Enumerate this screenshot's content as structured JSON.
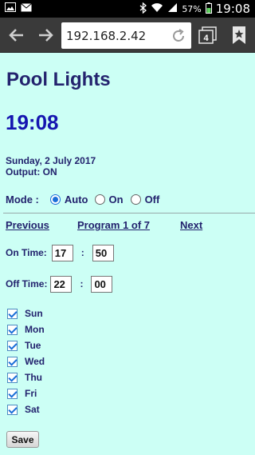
{
  "status_bar": {
    "time": "19:08",
    "battery": "57%",
    "icons": [
      "image-icon",
      "mail-icon",
      "bluetooth-icon",
      "wifi-icon",
      "signal-icon",
      "battery-icon"
    ]
  },
  "browser": {
    "url": "192.168.2.42",
    "tab_count": "4",
    "icons": [
      "back-arrow-icon",
      "forward-arrow-icon",
      "reload-icon",
      "tabs-icon",
      "bookmark-star-icon"
    ]
  },
  "page": {
    "title": "Pool Lights",
    "clock": "19:08",
    "date": "Sunday, 2 July 2017",
    "output": "Output: ON",
    "mode": {
      "label": "Mode :",
      "selected": "Auto",
      "options": [
        "Auto",
        "On",
        "Off"
      ]
    },
    "nav": {
      "previous": "Previous",
      "program": "Program 1 of 7",
      "next": "Next"
    },
    "on_time": {
      "label": "On Time:",
      "hour": "17",
      "minute": "50",
      "separator": ":"
    },
    "off_time": {
      "label": "Off Time:",
      "hour": "22",
      "minute": "00",
      "separator": ":"
    },
    "days": [
      {
        "label": "Sun",
        "checked": true
      },
      {
        "label": "Mon",
        "checked": true
      },
      {
        "label": "Tue",
        "checked": true
      },
      {
        "label": "Wed",
        "checked": true
      },
      {
        "label": "Thu",
        "checked": true
      },
      {
        "label": "Fri",
        "checked": true
      },
      {
        "label": "Sat",
        "checked": true
      }
    ],
    "save_label": "Save"
  },
  "colors": {
    "page_background": "#ccfff5",
    "title_text": "#23236e",
    "clock_text": "#1515b0",
    "toolbar": "#3a3a3a"
  }
}
